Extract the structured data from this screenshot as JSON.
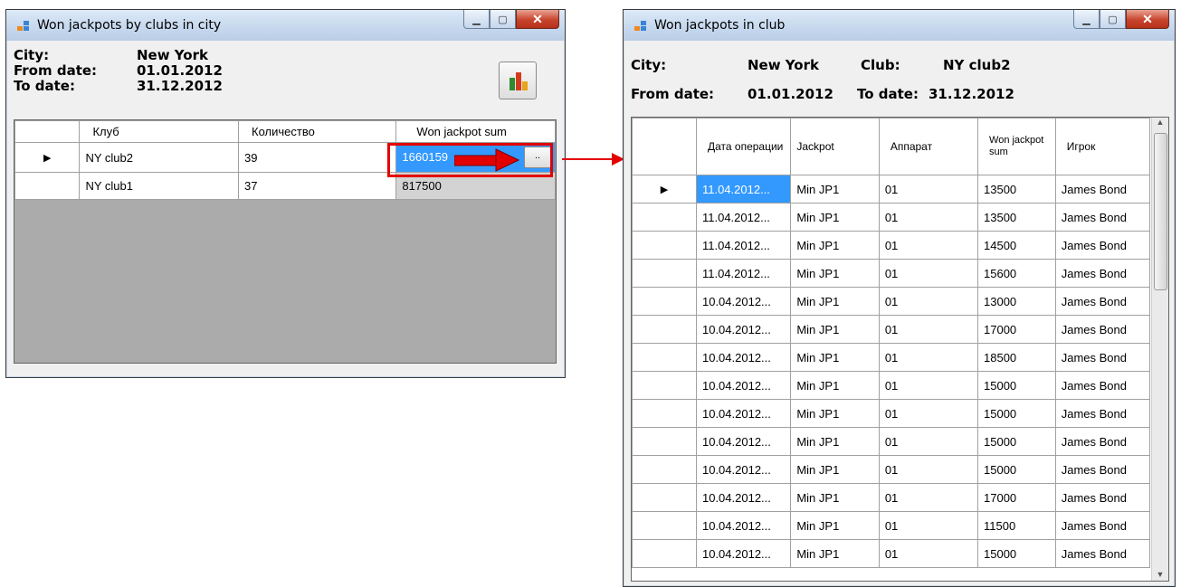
{
  "left_window": {
    "title": "Won jackpots by clubs in city",
    "labels": {
      "city": "City:",
      "from_date": "From date:",
      "to_date": "To date:"
    },
    "values": {
      "city": "New York",
      "from_date": "01.01.2012",
      "to_date": "31.12.2012"
    },
    "chart_button_icon": "bar-chart-icon",
    "columns": [
      "Клуб",
      "Количество",
      "Won jackpot sum"
    ],
    "rows": [
      {
        "club": "NY club2",
        "count": "39",
        "sum": "1660159"
      },
      {
        "club": "NY club1",
        "count": "37",
        "sum": "817500"
      }
    ],
    "ellipsis_button": ".."
  },
  "right_window": {
    "title": "Won jackpots in club",
    "labels": {
      "city": "City:",
      "club": "Club:",
      "from_date": "From date:",
      "to_date": "To date:"
    },
    "values": {
      "city": "New York",
      "club": "NY club2",
      "from_date": "01.01.2012",
      "to_date": "31.12.2012"
    },
    "columns": [
      "Дата операции",
      "Jackpot",
      "Аппарат",
      "Won jackpot sum",
      "Игрок"
    ],
    "rows": [
      [
        "11.04.2012...",
        "Min JP1",
        "01",
        "13500",
        "James Bond"
      ],
      [
        "11.04.2012...",
        "Min JP1",
        "01",
        "13500",
        "James Bond"
      ],
      [
        "11.04.2012...",
        "Min JP1",
        "01",
        "14500",
        "James Bond"
      ],
      [
        "11.04.2012...",
        "Min JP1",
        "01",
        "15600",
        "James Bond"
      ],
      [
        "10.04.2012...",
        "Min JP1",
        "01",
        "13000",
        "James Bond"
      ],
      [
        "10.04.2012...",
        "Min JP1",
        "01",
        "17000",
        "James Bond"
      ],
      [
        "10.04.2012...",
        "Min JP1",
        "01",
        "18500",
        "James Bond"
      ],
      [
        "10.04.2012...",
        "Min JP1",
        "01",
        "15000",
        "James Bond"
      ],
      [
        "10.04.2012...",
        "Min JP1",
        "01",
        "15000",
        "James Bond"
      ],
      [
        "10.04.2012...",
        "Min JP1",
        "01",
        "15000",
        "James Bond"
      ],
      [
        "10.04.2012...",
        "Min JP1",
        "01",
        "15000",
        "James Bond"
      ],
      [
        "10.04.2012...",
        "Min JP1",
        "01",
        "17000",
        "James Bond"
      ],
      [
        "10.04.2012...",
        "Min JP1",
        "01",
        "11500",
        "James Bond"
      ],
      [
        "10.04.2012...",
        "Min JP1",
        "01",
        "15000",
        "James Bond"
      ]
    ]
  },
  "colors": {
    "highlight": "#e30000",
    "selection": "#3399ff"
  }
}
